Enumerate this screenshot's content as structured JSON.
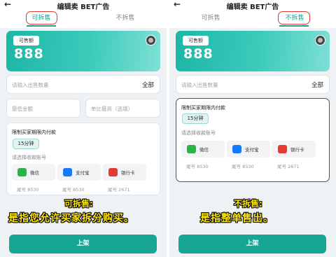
{
  "screen": {
    "title": "编辑卖 BET广告",
    "back_icon": "←",
    "tabs": [
      "可拆售",
      "不拆售"
    ]
  },
  "balance": {
    "label": "可售额",
    "amount": "888"
  },
  "form": {
    "quantity_placeholder": "请输入出售数量",
    "all_label": "全部",
    "min_placeholder": "最低金额",
    "max_placeholder": "单比最高（选填）"
  },
  "limit": {
    "title": "限制买家期限内付款",
    "minutes": "15分钟",
    "select_account": "请选择收款账号"
  },
  "payments": [
    {
      "name": "微信",
      "tail": "尾号 8530",
      "icon": "wechat-icon",
      "color": "#2bb34a"
    },
    {
      "name": "支付宝",
      "tail": "尾号 8530",
      "icon": "alipay-icon",
      "color": "#1677ff"
    },
    {
      "name": "银行卡",
      "tail": "尾号 2671",
      "icon": "bank-card-icon",
      "color": "#e53935"
    }
  ],
  "submit_label": "上架",
  "captions": {
    "left_title": "可拆售:",
    "left_body": "是指您允许买家拆分购买。",
    "right_title": "不拆售:",
    "right_body": "是指整单售出。"
  },
  "colors": {
    "accent": "#17a596",
    "highlight": "#e53935",
    "caption": "#ffe600"
  }
}
